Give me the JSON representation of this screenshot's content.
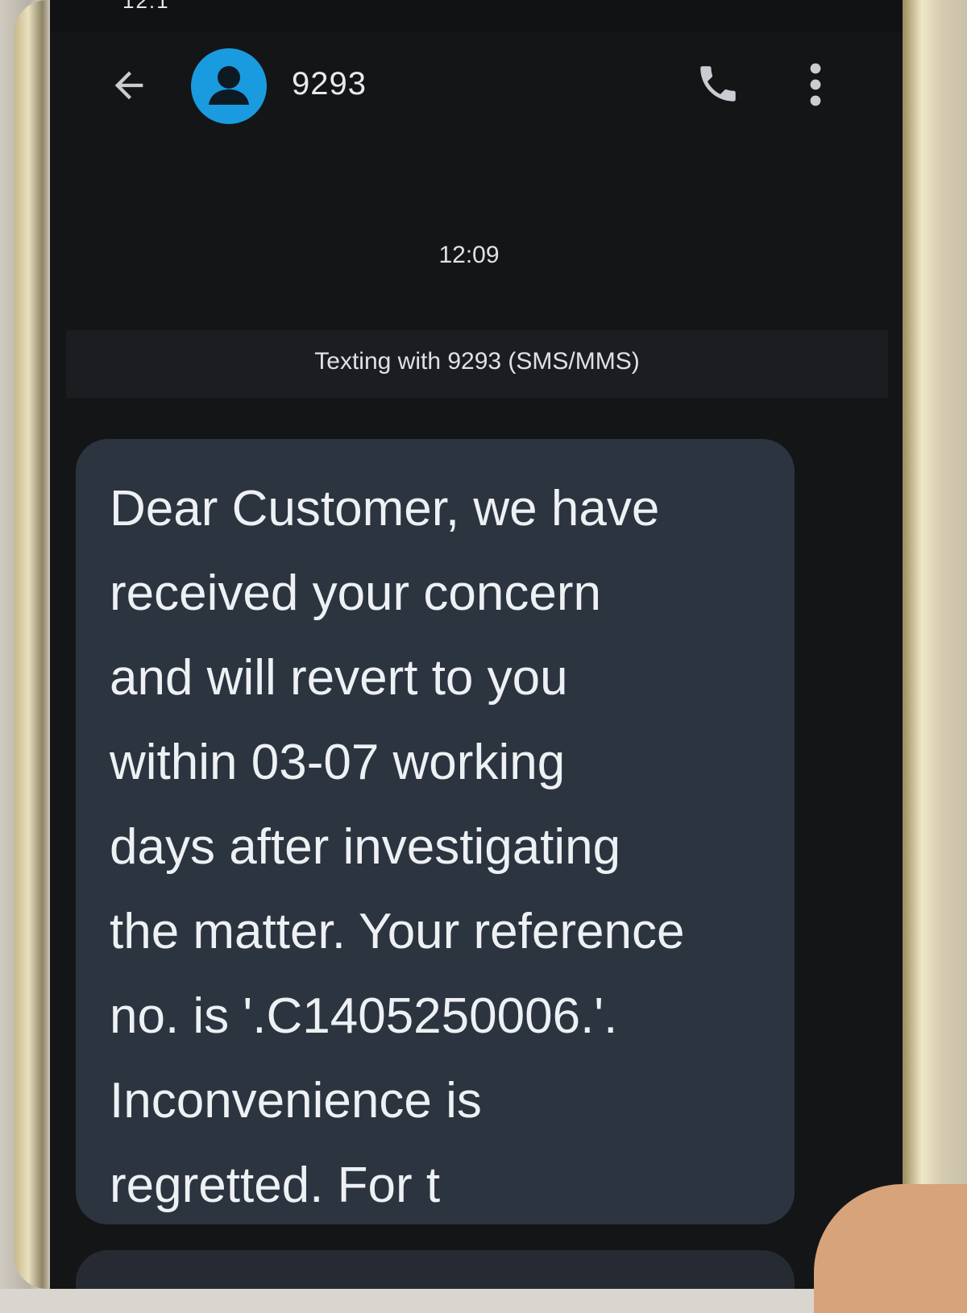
{
  "status_bar": {
    "time_fragment": "12:1"
  },
  "header": {
    "contact_title": "9293",
    "back_icon": "arrow-left-icon",
    "avatar_icon": "person-avatar-icon",
    "call_icon": "phone-icon",
    "more_icon": "more-vert-icon"
  },
  "conversation": {
    "timestamp": "12:09",
    "info_banner": "Texting with 9293 (SMS/MMS)",
    "message_text": "Dear Customer, we have\nreceived your concern\nand will revert to you\nwithin 03-07 working\ndays after investigating\nthe matter. Your reference\nno. is '.C1405250006.'.\nInconvenience is\nregretted. For t"
  },
  "colors": {
    "accent": "#1a9be0",
    "bubble": "#2c3440",
    "background": "#141517"
  }
}
